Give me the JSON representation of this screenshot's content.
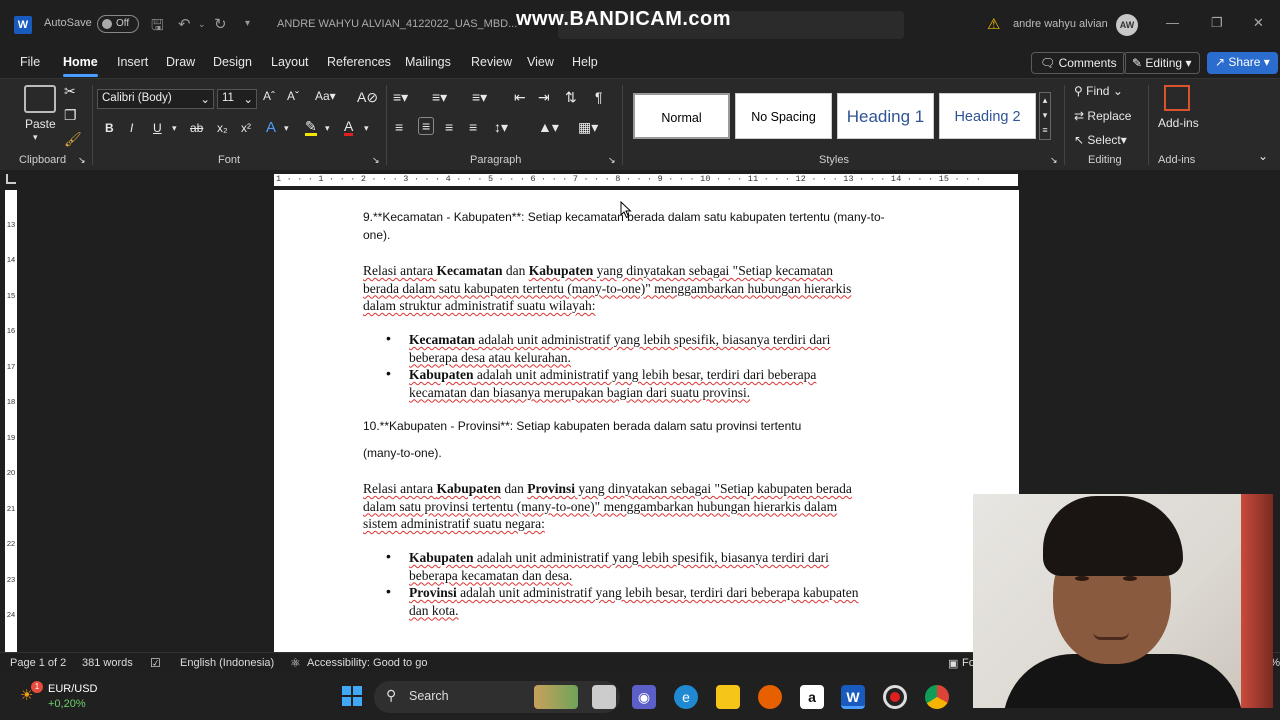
{
  "titlebar": {
    "autosave_label": "AutoSave",
    "autosave_state": "Off",
    "document_title": "ANDRE WAHYU ALVIAN_4122022_UAS_MBD...",
    "watermark": "www.BANDICAM.com",
    "username": "andre wahyu alvian",
    "avatar_initials": "AW"
  },
  "menu": {
    "tabs": [
      "File",
      "Home",
      "Insert",
      "Draw",
      "Design",
      "Layout",
      "References",
      "Mailings",
      "Review",
      "View",
      "Help"
    ],
    "active_tab": "Home",
    "comments_label": "Comments",
    "editing_label": "Editing",
    "share_label": "Share"
  },
  "ribbon": {
    "clipboard": {
      "paste_label": "Paste",
      "group_label": "Clipboard"
    },
    "font": {
      "font_name": "Calibri (Body)",
      "font_size": "11",
      "group_label": "Font"
    },
    "paragraph": {
      "group_label": "Paragraph"
    },
    "styles": {
      "items": [
        "Normal",
        "No Spacing",
        "Heading 1",
        "Heading 2"
      ],
      "group_label": "Styles"
    },
    "editing": {
      "find_label": "Find",
      "replace_label": "Replace",
      "select_label": "Select",
      "group_label": "Editing"
    },
    "addins": {
      "button_label": "Add-ins",
      "group_label": "Add-ins"
    }
  },
  "ruler": {
    "ticks": "1 · · · 1 · · · 2 · · · 3 · · · 4 · · · 5 · · · 6 · · · 7 · · · 8 · · · 9 · · · 10 · · · 11 · · · 12 · · · 13 · · · 14 · · · 15 · · ·",
    "vertical": [
      "13",
      "14",
      "15",
      "16",
      "17",
      "18",
      "19",
      "20",
      "21",
      "22",
      "23",
      "24"
    ]
  },
  "document": {
    "item9_line1": "9.**Kecamatan - Kabupaten**: Setiap kecamatan berada dalam satu kabupaten tertentu (many-to-",
    "item9_line2": "one).",
    "rel1_line1_pre": "Relasi antara ",
    "rel1_b1": "Kecamatan",
    "rel1_mid": " dan ",
    "rel1_b2": "Kabupaten",
    "rel1_line1_post": " yang dinyatakan sebagai \"Setiap kecamatan",
    "rel1_line2": "berada dalam satu kabupaten tertentu (many-to-one)\" menggambarkan hubungan hierarkis",
    "rel1_line3": "dalam struktur administratif suatu wilayah:",
    "b1_bold": "Kecamatan",
    "b1_line1": " adalah unit administratif yang lebih spesifik, biasanya terdiri dari",
    "b1_line2": "beberapa desa atau kelurahan.",
    "b2_bold": "Kabupaten",
    "b2_line1": " adalah unit administratif yang lebih besar, terdiri dari beberapa",
    "b2_line2": "kecamatan dan biasanya merupakan bagian dari suatu provinsi.",
    "item10_line1": "10.**Kabupaten - Provinsi**: Setiap kabupaten berada dalam satu provinsi tertentu",
    "item10_line2": "(many-to-one).",
    "rel2_line1_pre": "Relasi antara ",
    "rel2_b1": "Kabupaten",
    "rel2_mid": " dan ",
    "rel2_b2": "Provinsi",
    "rel2_line1_post": " yang dinyatakan sebagai \"Setiap kabupaten berada",
    "rel2_line2": "dalam satu provinsi tertentu (many-to-one)\" menggambarkan hubungan hierarkis dalam",
    "rel2_line3": "sistem administratif suatu negara:",
    "b3_bold": "Kabupaten",
    "b3_line1": " adalah unit administratif yang lebih spesifik, biasanya terdiri dari",
    "b3_line2": "beberapa kecamatan dan desa.",
    "b4_bold": "Provinsi",
    "b4_line1": " adalah unit administratif yang lebih besar, terdiri dari beberapa kabupaten",
    "b4_line2": "dan kota."
  },
  "status": {
    "page": "Page 1 of 2",
    "words": "381 words",
    "language": "English (Indonesia)",
    "accessibility": "Accessibility: Good to go",
    "focus_partial": "Fo",
    "zoom_partial": "00%"
  },
  "taskbar": {
    "ticker_symbol": "EUR/USD",
    "ticker_change": "+0,20%",
    "notification_count": "1",
    "search_label": "Search"
  },
  "colors": {
    "accent": "#4a9eff",
    "share_button": "#2b6ccf",
    "word_blue": "#185abd",
    "heading_blue": "#2f5496",
    "ticker_up": "#6ccf6c"
  }
}
